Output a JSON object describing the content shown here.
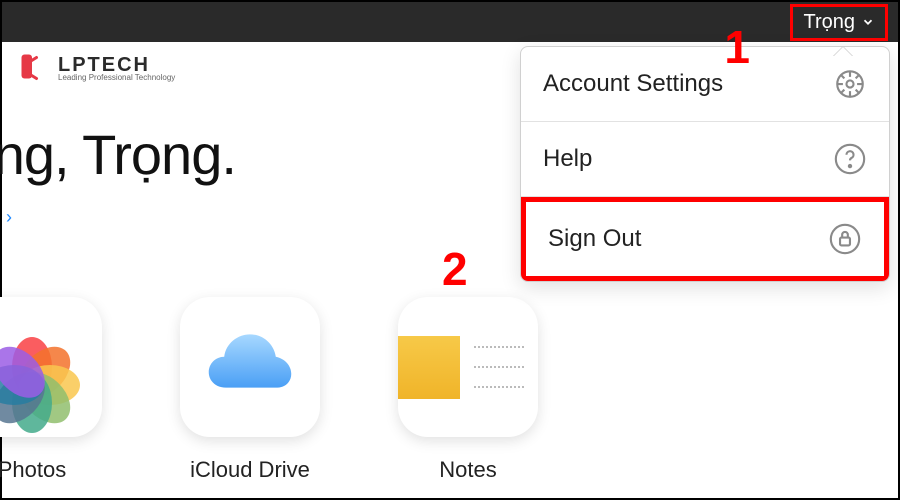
{
  "topbar": {
    "user_name": "Trọng"
  },
  "logo": {
    "text": "LPTECH",
    "sub": "Leading Professional Technology"
  },
  "greeting": "ening, Trọng.",
  "menu": {
    "items": [
      {
        "label": "Account Settings",
        "icon": "gear-icon"
      },
      {
        "label": "Help",
        "icon": "help-icon"
      },
      {
        "label": "Sign Out",
        "icon": "lock-icon",
        "highlighted": true
      }
    ]
  },
  "apps": [
    {
      "label": "Photos",
      "icon": "photos-icon"
    },
    {
      "label": "iCloud Drive",
      "icon": "cloud-icon"
    },
    {
      "label": "Notes",
      "icon": "notes-icon"
    }
  ],
  "annotations": {
    "1": "1",
    "2": "2"
  },
  "colors": {
    "highlight": "#ff0000",
    "cloud": "#6fb8f5",
    "notes": "#f7c948"
  }
}
